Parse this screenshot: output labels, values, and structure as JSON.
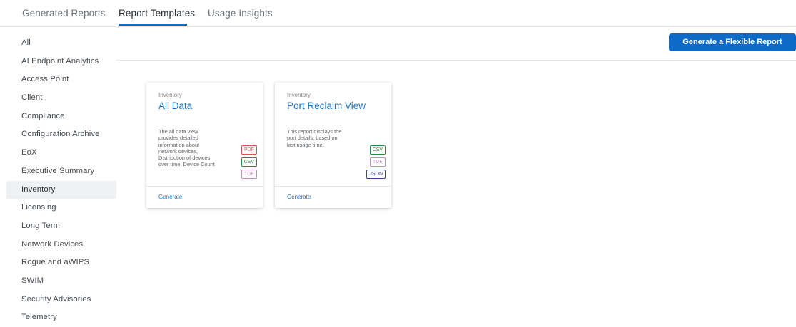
{
  "tabs": [
    {
      "label": "Generated Reports"
    },
    {
      "label": "Report Templates"
    },
    {
      "label": "Usage Insights"
    }
  ],
  "active_tab": "Report Templates",
  "generate_button": {
    "label": "Generate a Flexible Report"
  },
  "sidebar": {
    "active_item": "Inventory",
    "items": [
      {
        "label": "All"
      },
      {
        "label": "AI Endpoint Analytics"
      },
      {
        "label": "Access Point"
      },
      {
        "label": "Client"
      },
      {
        "label": "Compliance"
      },
      {
        "label": "Configuration Archive"
      },
      {
        "label": "EoX"
      },
      {
        "label": "Executive Summary"
      },
      {
        "label": "Inventory"
      },
      {
        "label": "Licensing"
      },
      {
        "label": "Long Term"
      },
      {
        "label": "Network Devices"
      },
      {
        "label": "Rogue and aWIPS"
      },
      {
        "label": "SWIM"
      },
      {
        "label": "Security Advisories"
      },
      {
        "label": "Telemetry"
      }
    ]
  },
  "cards": [
    {
      "category": "Inventory",
      "title": "All Data",
      "description_lines": [
        "The all data view",
        "provides detailed",
        "information about",
        "network devices,",
        "Distribution of devices",
        "over time, Device Count"
      ],
      "formats": [
        {
          "label": "PDF",
          "color": "#d9534f"
        },
        {
          "label": "CSV",
          "color": "#2e8b3e"
        },
        {
          "label": "TDE",
          "color": "#c98bc4"
        }
      ],
      "action": "Generate"
    },
    {
      "category": "Inventory",
      "title": "Port Reclaim View",
      "description_lines": [
        "This report displays the",
        "port details, based on",
        "last usage time."
      ],
      "formats": [
        {
          "label": "CSV",
          "color": "#2e8b3e"
        },
        {
          "label": "TDE",
          "color": "#c98bc4"
        },
        {
          "label": "JSON",
          "color": "#3a3f8f"
        }
      ],
      "action": "Generate"
    }
  ],
  "colors": {
    "accent": "#0d6ac6",
    "link": "#1b73c2"
  }
}
